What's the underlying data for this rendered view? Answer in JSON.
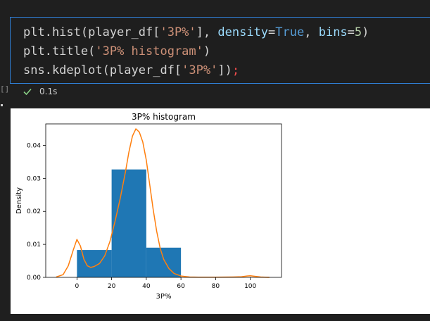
{
  "cell": {
    "code_lines": [
      [
        {
          "t": "plt.hist(player_df[",
          "c": "fn"
        },
        {
          "t": "'3P%'",
          "c": "str"
        },
        {
          "t": "], ",
          "c": "fn"
        },
        {
          "t": "density",
          "c": "kw"
        },
        {
          "t": "=",
          "c": "fn"
        },
        {
          "t": "True",
          "c": "bool"
        },
        {
          "t": ", ",
          "c": "fn"
        },
        {
          "t": "bins",
          "c": "kw"
        },
        {
          "t": "=",
          "c": "fn"
        },
        {
          "t": "5",
          "c": "num"
        },
        {
          "t": ")",
          "c": "fn"
        }
      ],
      [
        {
          "t": "plt.title(",
          "c": "fn"
        },
        {
          "t": "'3P% histogram'",
          "c": "str"
        },
        {
          "t": ")",
          "c": "fn"
        }
      ],
      [
        {
          "t": "sns.kdeplot(player_df[",
          "c": "fn"
        },
        {
          "t": "'3P%'",
          "c": "str"
        },
        {
          "t": "])",
          "c": "fn"
        },
        {
          "t": ";",
          "c": "semi"
        }
      ]
    ],
    "status": {
      "icon": "check-icon",
      "exec_time": "0.1s",
      "success_color": "#89d185"
    },
    "gutter_bracket": "[]"
  },
  "chart_data": {
    "type": "bar",
    "title": "3P% histogram",
    "xlabel": "3P%",
    "ylabel": "Density",
    "xlim": [
      -18,
      118
    ],
    "ylim": [
      0,
      0.0465
    ],
    "xticks": [
      0,
      20,
      40,
      60,
      80,
      100
    ],
    "yticks": [
      0.0,
      0.01,
      0.02,
      0.03,
      0.04
    ],
    "ytick_labels": [
      "0.00",
      "0.01",
      "0.02",
      "0.03",
      "0.04"
    ],
    "bins": [
      {
        "x0": 0,
        "x1": 20,
        "value": 0.0083
      },
      {
        "x0": 20,
        "x1": 40,
        "value": 0.0327
      },
      {
        "x0": 40,
        "x1": 60,
        "value": 0.009
      }
    ],
    "bar_color": "#1f77b4",
    "kde": {
      "color": "#ff7f0e",
      "x": [
        -12,
        -8,
        -5,
        -2,
        0,
        2,
        4,
        6,
        8,
        10,
        13,
        16,
        19,
        22,
        25,
        28,
        30,
        32,
        34,
        36,
        38,
        40,
        42,
        44,
        46,
        48,
        50,
        53,
        56,
        60,
        65,
        70,
        80,
        90,
        95,
        98,
        100,
        103,
        106,
        111
      ],
      "y": [
        0.0001,
        0.0008,
        0.0035,
        0.0085,
        0.0115,
        0.0095,
        0.0055,
        0.0035,
        0.003,
        0.0033,
        0.0042,
        0.0065,
        0.0108,
        0.017,
        0.024,
        0.032,
        0.038,
        0.0428,
        0.045,
        0.044,
        0.041,
        0.0355,
        0.028,
        0.0205,
        0.014,
        0.0088,
        0.0055,
        0.0027,
        0.0012,
        0.0004,
        0.0001,
        5e-05,
        5e-05,
        0.0001,
        0.0002,
        0.0004,
        0.0005,
        0.0003,
        0.0001,
        0.0
      ]
    }
  }
}
